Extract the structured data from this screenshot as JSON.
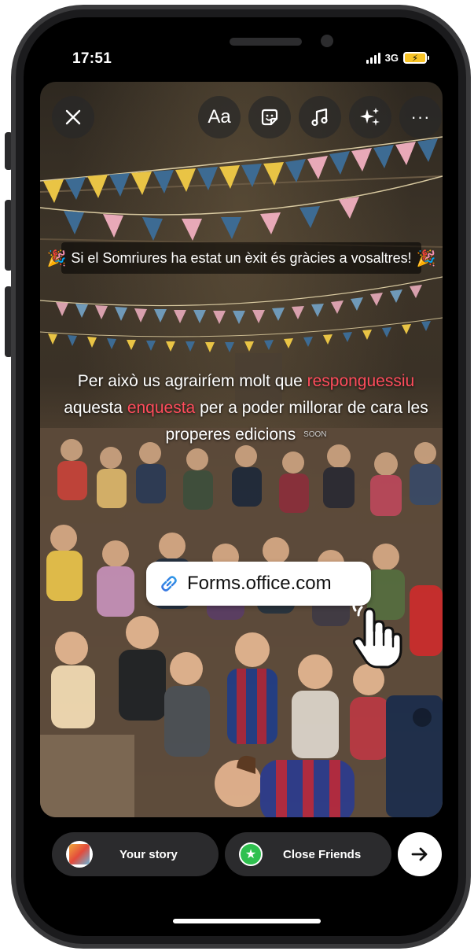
{
  "status_bar": {
    "time": "17:51",
    "network": "3G"
  },
  "toolbar": {
    "close_icon": "close-icon",
    "text_label": "Aa",
    "sticker_icon": "sticker-icon",
    "music_icon": "music-icon",
    "effects_icon": "sparkles-icon",
    "more_label": "···"
  },
  "story": {
    "banner_text": "Si el Somriures ha estat un èxit és gràcies a vosaltres!",
    "message": {
      "part1": "Per això us agrairíem molt que ",
      "highlight1": "responguessiu",
      "part2": " aquesta ",
      "highlight2": "enquesta",
      "part3": " per a poder millorar de cara les properes edicions",
      "soon_tag": "SOON"
    },
    "link_sticker": {
      "label": "Forms.office.com",
      "icon": "link-icon"
    }
  },
  "share_bar": {
    "your_story_label": "Your story",
    "close_friends_label": "Close Friends",
    "next_icon": "arrow-right-icon"
  },
  "colors": {
    "highlight": "#ff4c5c",
    "close_friends_green": "#2fc04f",
    "battery": "#f7c325"
  }
}
